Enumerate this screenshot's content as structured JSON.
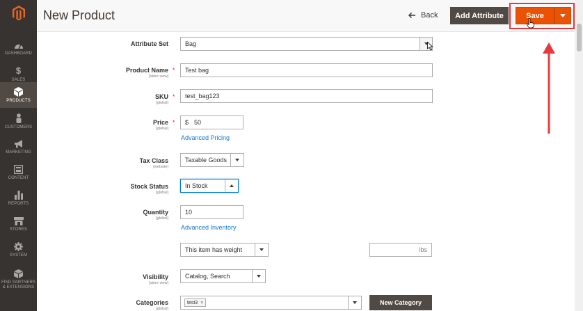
{
  "sidebar": {
    "items": [
      {
        "label": "DASHBOARD",
        "icon": "dashboard-icon"
      },
      {
        "label": "SALES",
        "icon": "dollar-icon",
        "glyph": "$"
      },
      {
        "label": "PRODUCTS",
        "icon": "cube-icon"
      },
      {
        "label": "CUSTOMERS",
        "icon": "person-icon"
      },
      {
        "label": "MARKETING",
        "icon": "megaphone-icon"
      },
      {
        "label": "CONTENT",
        "icon": "content-icon"
      },
      {
        "label": "REPORTS",
        "icon": "bar-chart-icon"
      },
      {
        "label": "STORES",
        "icon": "store-icon"
      },
      {
        "label": "SYSTEM",
        "icon": "gear-icon"
      },
      {
        "label": "FIND PARTNERS & EXTENSIONS",
        "icon": "box-icon"
      }
    ]
  },
  "header": {
    "title": "New Product",
    "back_label": "Back",
    "add_attribute_label": "Add Attribute",
    "save_label": "Save"
  },
  "form": {
    "attribute_set": {
      "label": "Attribute Set",
      "value": "Bag"
    },
    "product_name": {
      "label": "Product Name",
      "scope": "[store view]",
      "value": "Test bag"
    },
    "sku": {
      "label": "SKU",
      "scope": "[global]",
      "value": "test_bag123"
    },
    "price": {
      "label": "Price",
      "scope": "[global]",
      "currency": "$",
      "value": "50",
      "link": "Advanced Pricing"
    },
    "tax_class": {
      "label": "Tax Class",
      "scope": "[website]",
      "value": "Taxable Goods"
    },
    "stock_status": {
      "label": "Stock Status",
      "scope": "[global]",
      "value": "In Stock"
    },
    "quantity": {
      "label": "Quantity",
      "scope": "[global]",
      "value": "10",
      "link": "Advanced Inventory"
    },
    "weight": {
      "value": "This item has weight",
      "unit": "lbs"
    },
    "visibility": {
      "label": "Visibility",
      "scope": "[store view]",
      "value": "Catalog, Search"
    },
    "categories": {
      "label": "Categories",
      "scope": "[global]",
      "tag": "test3",
      "tag_remove": "×",
      "new_category_label": "New Category"
    }
  },
  "colors": {
    "sidebar_bg": "#373330",
    "accent": "#eb5202",
    "link": "#1979c3",
    "highlight": "#e8383d"
  }
}
